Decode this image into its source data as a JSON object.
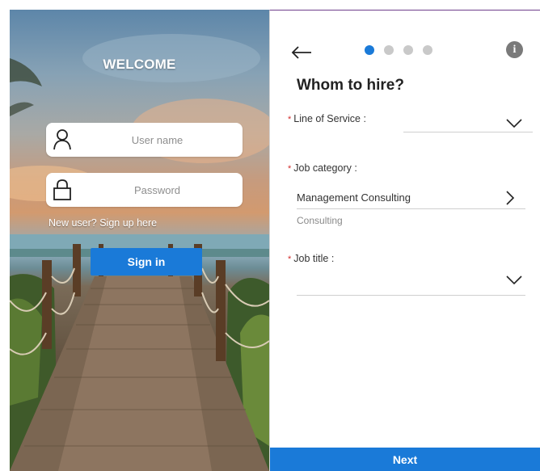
{
  "login": {
    "welcome": "WELCOME",
    "username_placeholder": "User name",
    "password_placeholder": "Password",
    "signup_link": "New user? Sign up here",
    "signin_label": "Sign in"
  },
  "form": {
    "steps_total": 4,
    "current_step": 1,
    "info_glyph": "i",
    "title": "Whom to hire?",
    "required_marker": "*",
    "fields": {
      "line_of_service": {
        "label": "Line of Service :",
        "value": ""
      },
      "job_category": {
        "label": "Job category :",
        "value": "Management Consulting",
        "subtext": "Consulting"
      },
      "job_title": {
        "label": "Job title :",
        "value": ""
      }
    },
    "next_label": "Next"
  },
  "icons": {
    "back": "arrow-left-icon",
    "info": "info-icon",
    "user": "user-icon",
    "lock": "lock-icon",
    "dropdown": "chevron-down-icon",
    "navigate": "chevron-right-icon"
  },
  "colors": {
    "accent": "#1a7ad8",
    "required": "#d32f2f",
    "step_inactive": "#c9c9c9",
    "info_bg": "#7a7a7a"
  }
}
